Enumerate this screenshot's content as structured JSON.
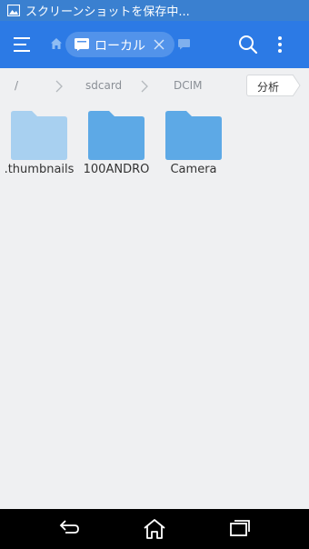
{
  "status_bar": {
    "notification_text": "スクリーンショットを保存中..."
  },
  "app_bar": {
    "tab_label": "ローカル"
  },
  "breadcrumb": {
    "root": "/",
    "items": [
      "sdcard",
      "DCIM"
    ],
    "analyze_label": "分析"
  },
  "folders": [
    {
      "name": ".thumbnails",
      "color": "#a8d0f0"
    },
    {
      "name": "100ANDRO",
      "color": "#5da9e6"
    },
    {
      "name": "Camera",
      "color": "#5da9e6"
    }
  ],
  "colors": {
    "status_bar": "#3a80d0",
    "app_bar": "#2c7ae5",
    "background": "#eff0f2",
    "nav_bar": "#000000"
  }
}
